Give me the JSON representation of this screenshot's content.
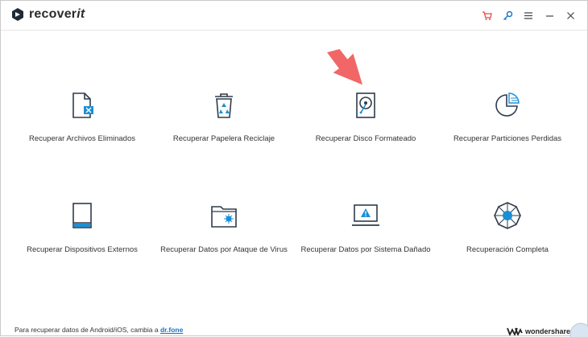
{
  "app": {
    "name_main": "recover",
    "name_suffix": "it"
  },
  "toolbar": {
    "icons": [
      "cart-icon",
      "key-icon",
      "menu-icon",
      "minimize-icon",
      "close-icon"
    ],
    "accent": "#e8483b",
    "blue": "#1a73c8"
  },
  "tiles": [
    {
      "label": "Recuperar Archivos Eliminados",
      "icon": "deleted-file-icon"
    },
    {
      "label": "Recuperar Papelera Reciclaje",
      "icon": "recycle-bin-icon"
    },
    {
      "label": "Recuperar Disco Formateado",
      "icon": "formatted-disk-icon"
    },
    {
      "label": "Recuperar Particiones Perdidas",
      "icon": "lost-partition-icon"
    },
    {
      "label": "Recuperar Dispositivos Externos",
      "icon": "external-device-icon"
    },
    {
      "label": "Recuperar Datos por Ataque de Virus",
      "icon": "virus-folder-icon"
    },
    {
      "label": "Recuperar Datos por Sistema Dañado",
      "icon": "crashed-system-icon"
    },
    {
      "label": "Recuperación Completa",
      "icon": "complete-recovery-icon"
    }
  ],
  "footer": {
    "text": "Para recuperar datos de Android/iOS, cambia a",
    "link": "dr.fone",
    "brand": "wondershare"
  },
  "colors": {
    "icon_stroke": "#2f3b4c",
    "icon_accent": "#1a8fd6",
    "annotation_arrow": "#f16767"
  }
}
